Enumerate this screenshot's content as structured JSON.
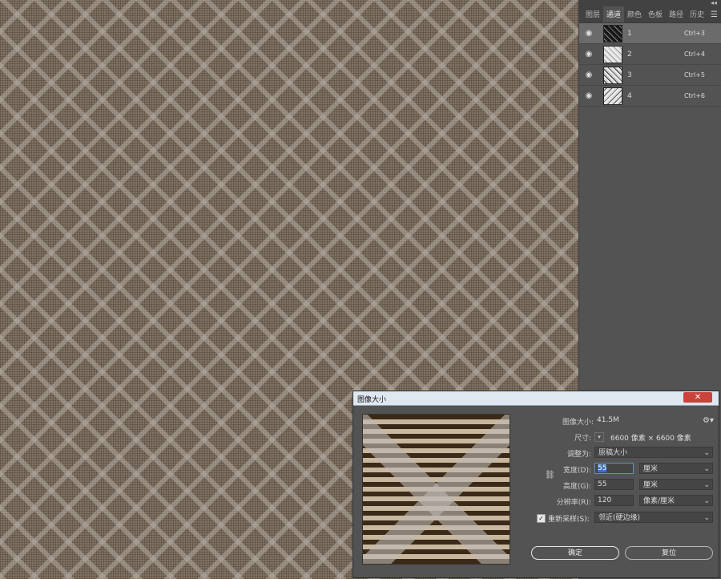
{
  "panel": {
    "tabs": [
      {
        "label": "图层"
      },
      {
        "label": "通道"
      },
      {
        "label": "颜色"
      },
      {
        "label": "色板"
      },
      {
        "label": "路径"
      },
      {
        "label": "历史"
      }
    ],
    "channels": [
      {
        "name": "1",
        "shortcut": "Ctrl+3"
      },
      {
        "name": "2",
        "shortcut": "Ctrl+4"
      },
      {
        "name": "3",
        "shortcut": "Ctrl+5"
      },
      {
        "name": "4",
        "shortcut": "Ctrl+6"
      }
    ]
  },
  "dialog": {
    "title": "图像大小",
    "image_size_label": "图像大小:",
    "image_size_value": "41.5M",
    "dimensions_label": "尺寸:",
    "dimensions_value": "6600 像素 × 6600 像素",
    "fit_to_label": "调整为:",
    "fit_to_value": "原稿大小",
    "width_label": "宽度(D):",
    "width_value": "55",
    "width_unit": "厘米",
    "height_label": "高度(G):",
    "height_value": "55",
    "height_unit": "厘米",
    "resolution_label": "分辨率(R):",
    "resolution_value": "120",
    "resolution_unit": "像素/厘米",
    "resample_label": "重新采样(S):",
    "resample_checked": true,
    "resample_value": "邻近(硬边缘)",
    "ok_label": "确定",
    "reset_label": "复位"
  }
}
